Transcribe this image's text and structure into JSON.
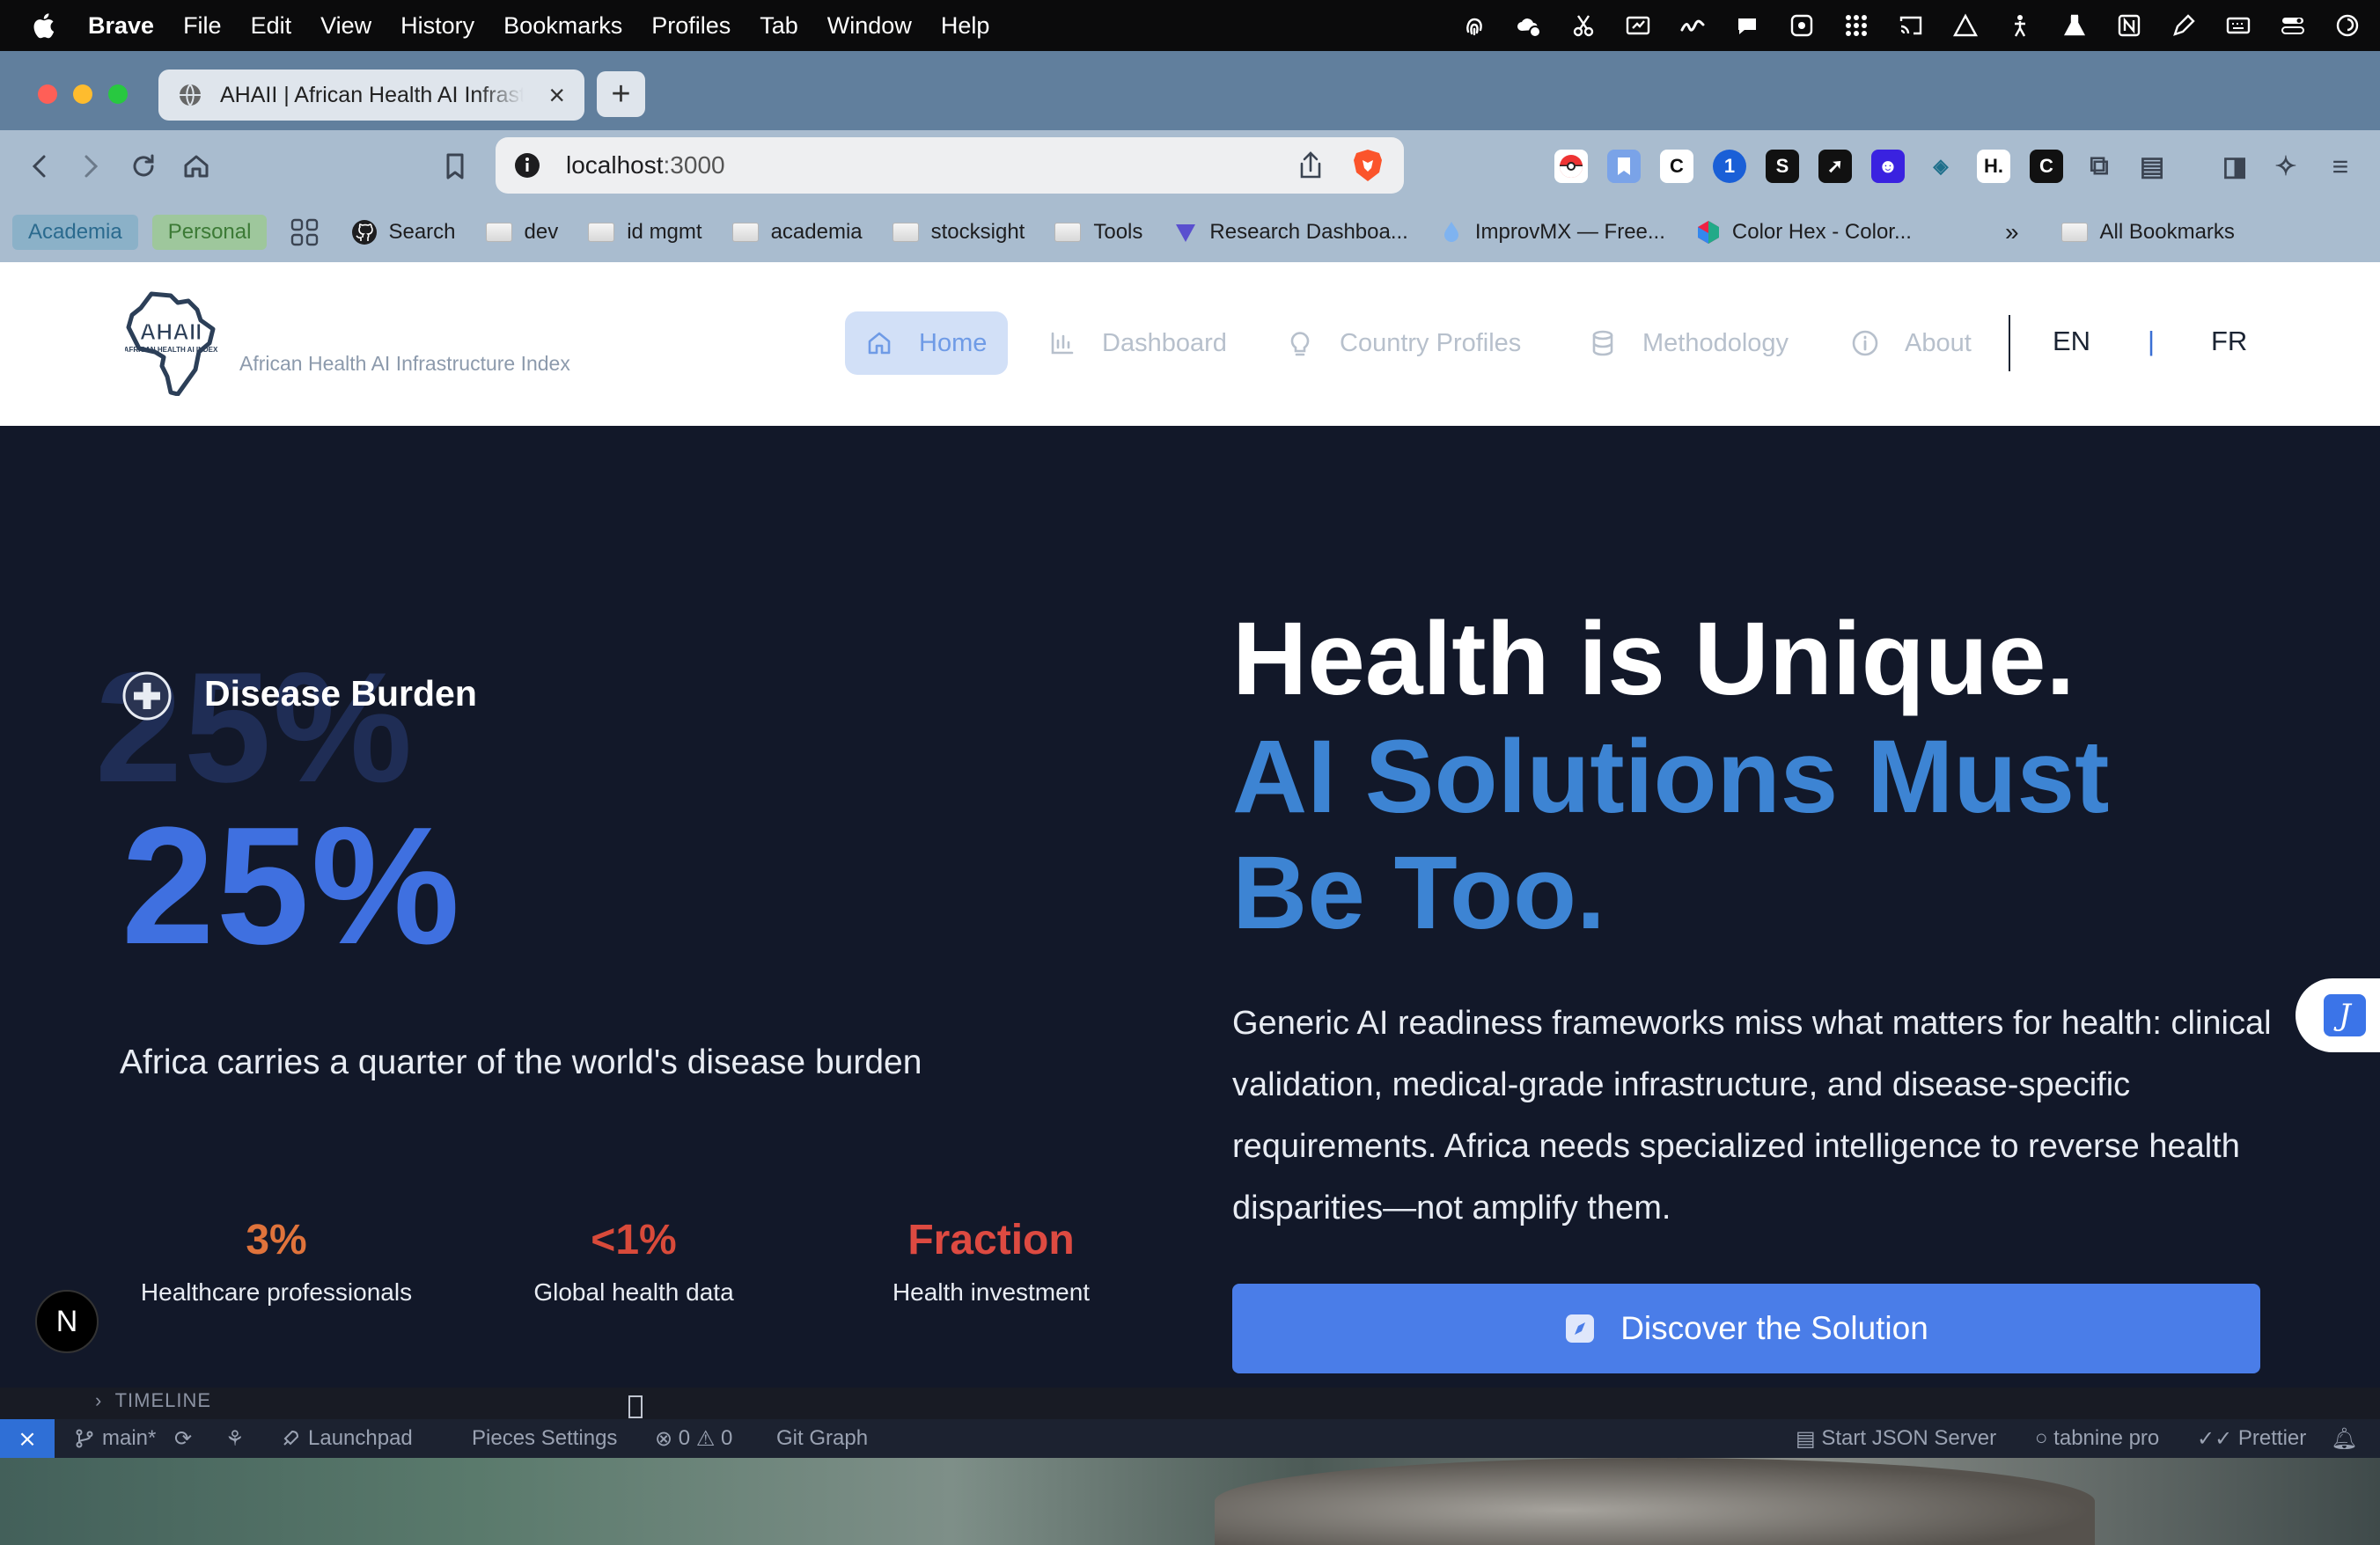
{
  "menubar": {
    "app": "Brave",
    "items": [
      "File",
      "Edit",
      "View",
      "History",
      "Bookmarks",
      "Profiles",
      "Tab",
      "Window",
      "Help"
    ]
  },
  "tab": {
    "title": "AHAII | African Health AI Infrastructure Index",
    "close": "×",
    "new_tab": "+"
  },
  "url": {
    "host": "localhost",
    "port": ":3000"
  },
  "bookmarks": {
    "profiles": [
      "Academia",
      "Personal"
    ],
    "items": [
      "Search",
      "dev",
      "id mgmt",
      "academia",
      "stocksight",
      "Tools",
      "Research Dashboa...",
      "ImprovMX — Free...",
      "Color Hex - Color..."
    ],
    "overflow": "»",
    "all": "All Bookmarks"
  },
  "header": {
    "logo_text": "AHAII",
    "logo_sub": "AFRICAN HEALTH AI INDEX",
    "tagline": "African Health AI Infrastructure Index",
    "nav": [
      "Home",
      "Dashboard",
      "Country Profiles",
      "Methodology",
      "About"
    ],
    "lang_en": "EN",
    "lang_sep": "|",
    "lang_fr": "FR"
  },
  "hero": {
    "burden_label": "Disease Burden",
    "big_value": "25%",
    "caption": "Africa carries a quarter of the world's disease burden",
    "stats": [
      {
        "value": "3%",
        "label": "Healthcare professionals"
      },
      {
        "value": "<1%",
        "label": "Global health data"
      },
      {
        "value": "Fraction",
        "label": "Health investment"
      }
    ],
    "headline_1": "Health is Unique.",
    "headline_2": "AI Solutions Must",
    "headline_3": "Be Too.",
    "body": "Generic AI readiness frameworks miss what matters for health: clinical validation, medical-grade infrastructure, and disease-specific requirements. Africa needs specialized intelligence to reverse health disparities—not amplify them.",
    "cta": "Discover the Solution"
  },
  "widgets": {
    "grammarly": "J",
    "next": "N"
  },
  "vscode": {
    "timeline": "TIMELINE",
    "branch": "main*",
    "launchpad": "Launchpad",
    "pieces": "Pieces Settings",
    "errors": "0",
    "warnings": "0",
    "git_graph": "Git Graph",
    "json_server": "Start JSON Server",
    "tabnine": "tabnine pro",
    "prettier": "Prettier"
  },
  "colors": {
    "hero_bg": "#121829",
    "accent_blue": "#3f70e0",
    "headline_blue": "#3d84d3",
    "cta_blue": "#4a7de8",
    "stat_orange": "#e0733b",
    "stat_red": "#d84a3a"
  }
}
